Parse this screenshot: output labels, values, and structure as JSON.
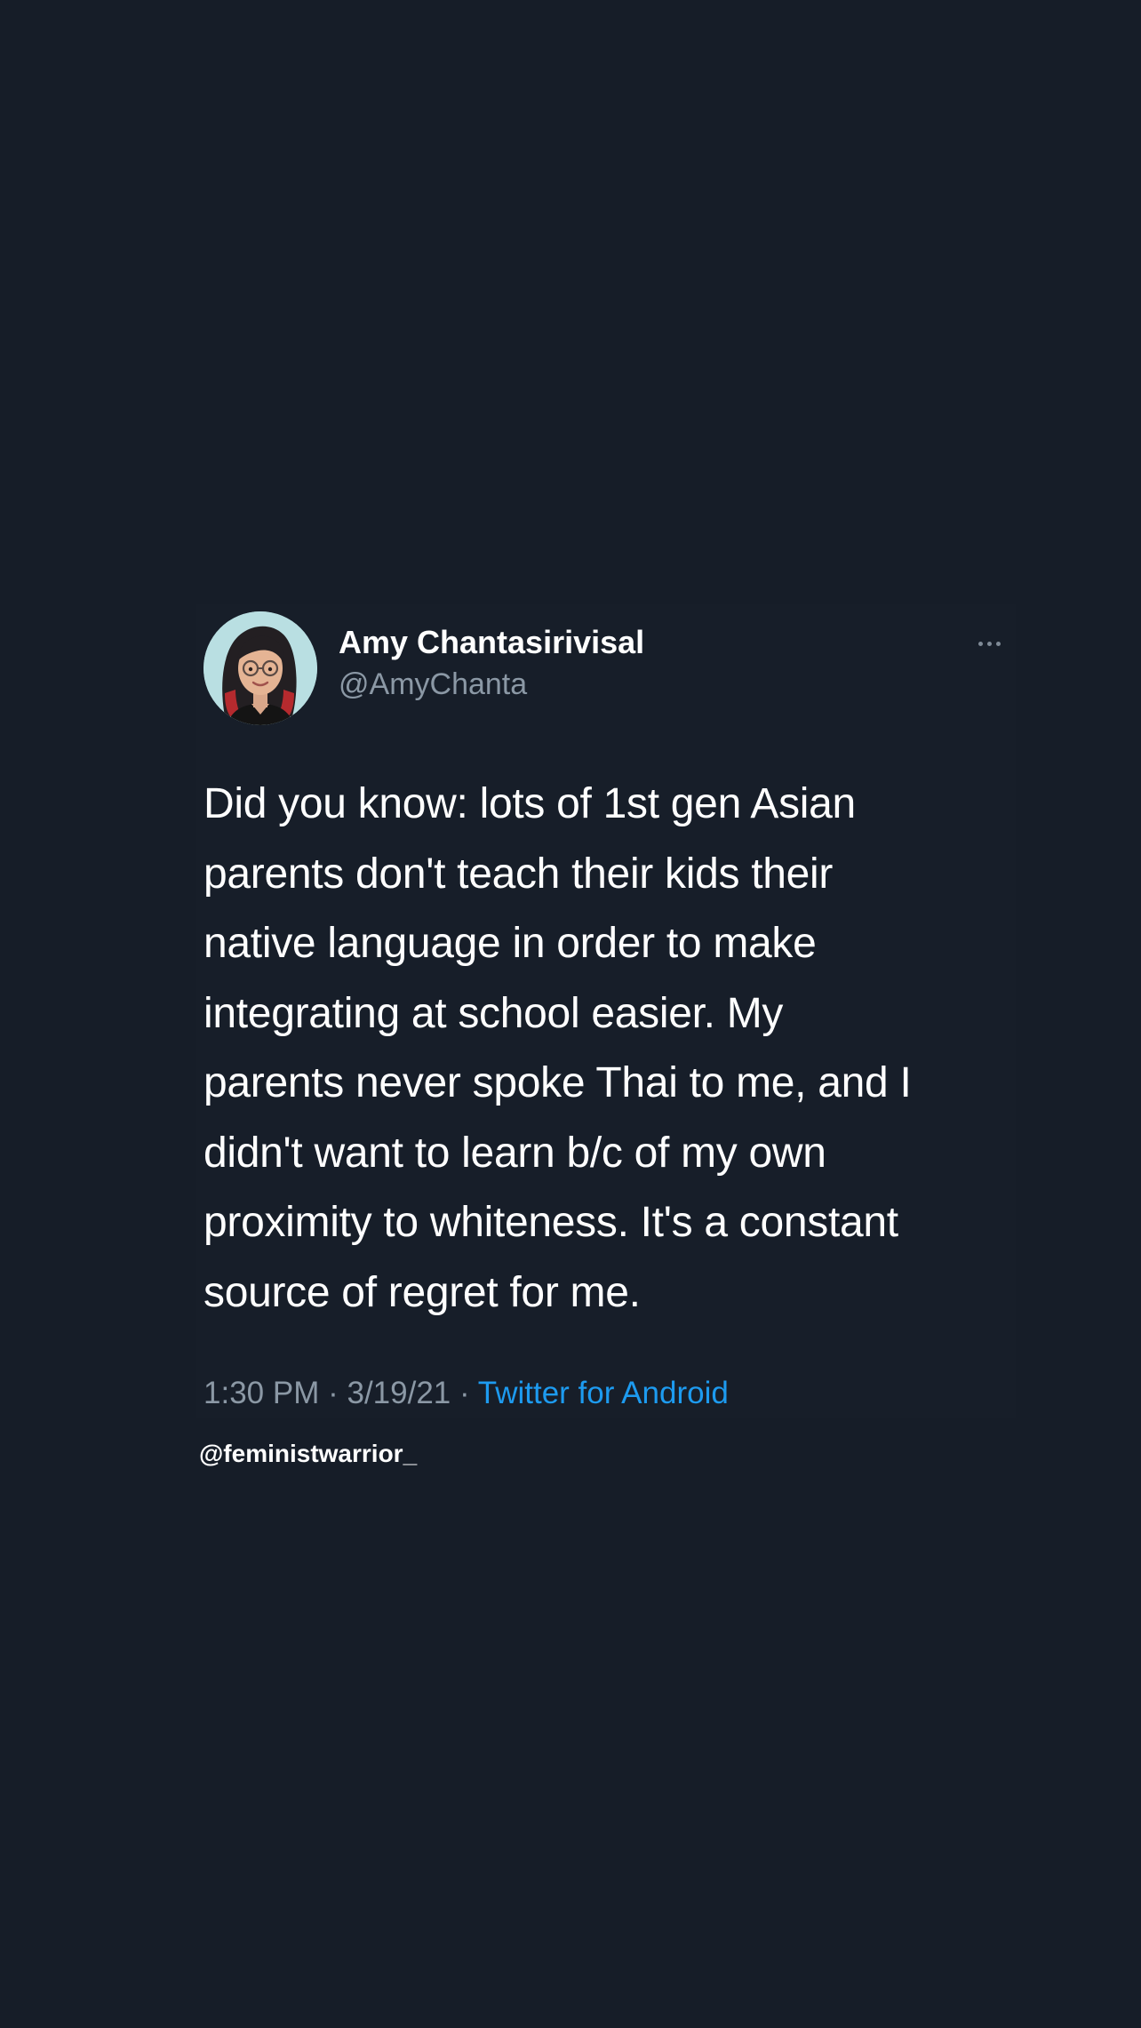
{
  "tweet": {
    "display_name": "Amy Chantasirivisal",
    "handle": "@AmyChanta",
    "text": "Did you know: lots of 1st gen Asian\nparents don't teach their kids their\nnative language in order to make\nintegrating at school easier. My\nparents never spoke Thai to me, and I\ndidn't want to learn b/c of my own\nproximity to whiteness. It's a constant\nsource of regret for me.",
    "time": "1:30 PM",
    "separator": "·",
    "date": "3/19/21",
    "source": "Twitter for Android",
    "avatar_icon": "cartoon-woman-avatar-icon",
    "more_icon": "more-options-icon"
  },
  "watermark": "@feministwarrior_",
  "colors": {
    "background": "#161d28",
    "primary_text": "#ffffff",
    "secondary_text": "#8b98a5",
    "accent_link": "#1d9bf0"
  }
}
